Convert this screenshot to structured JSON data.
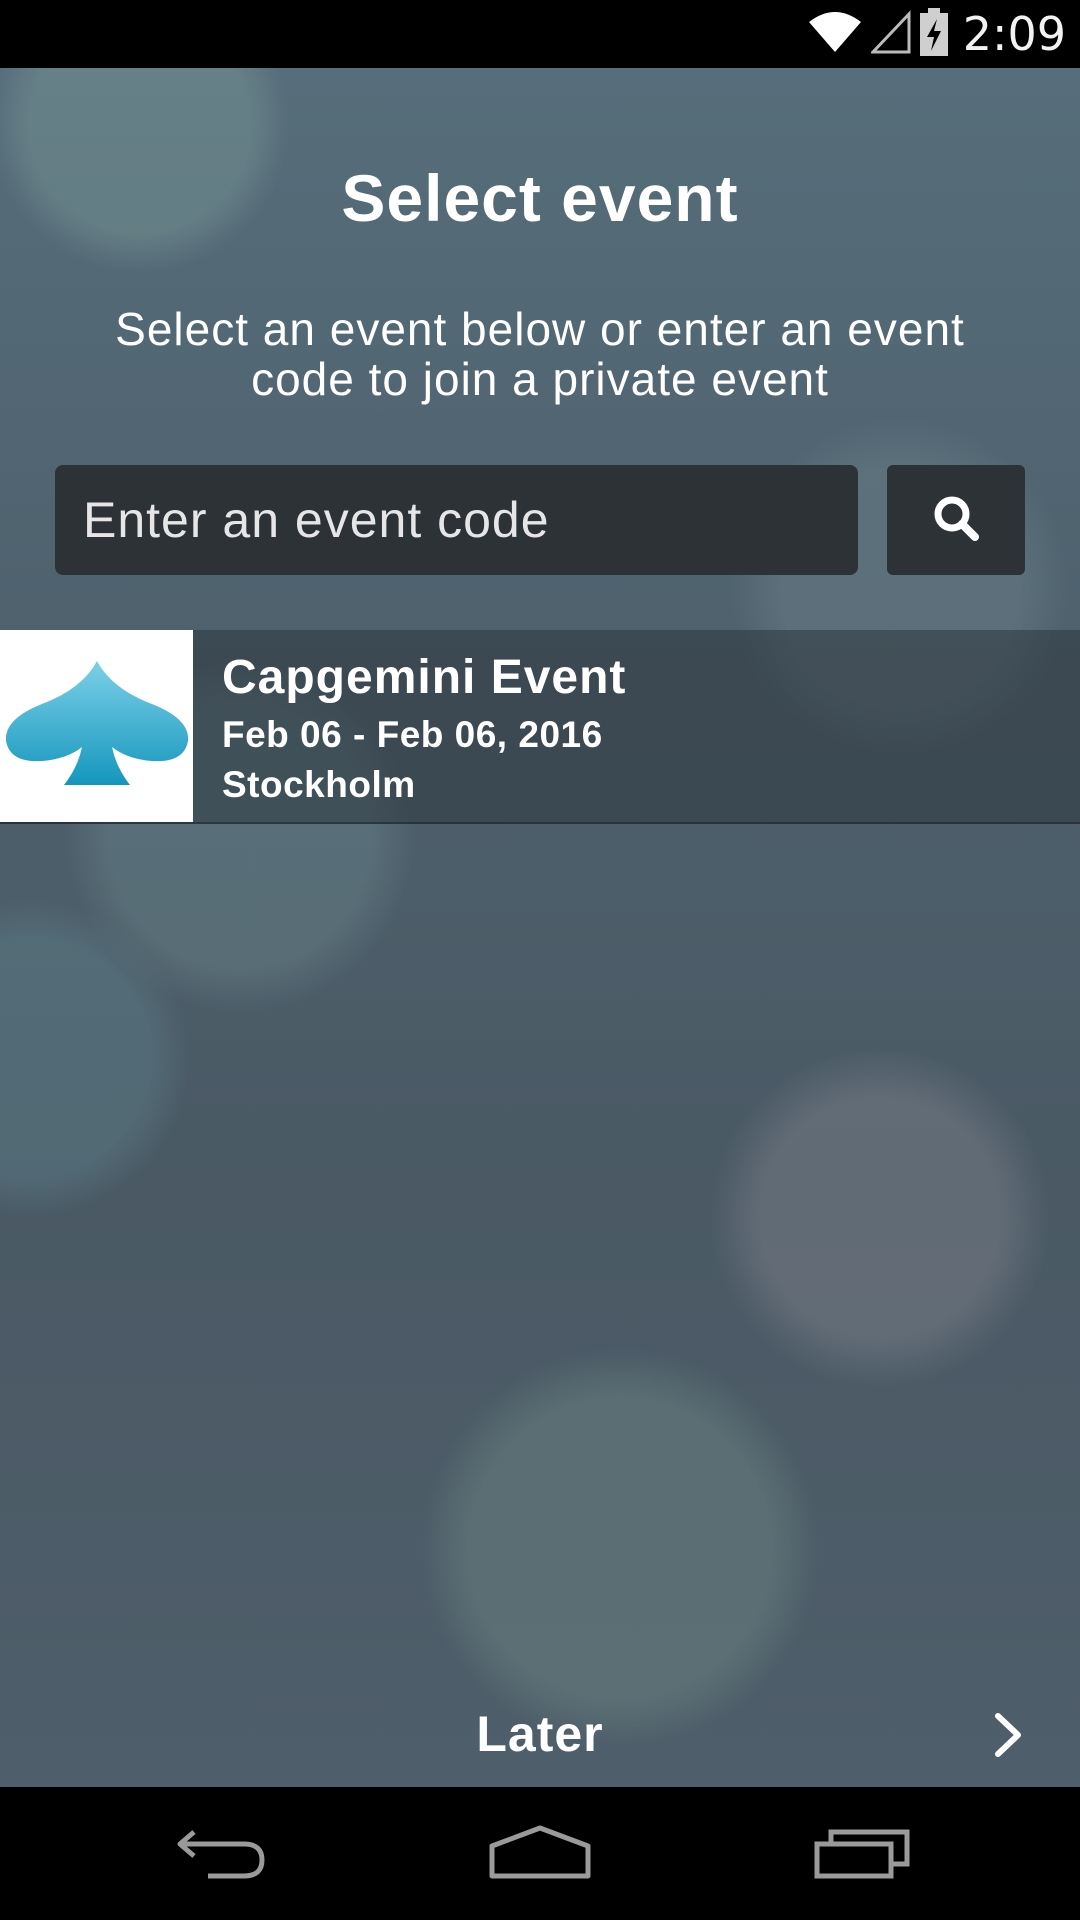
{
  "status_bar": {
    "time": "2:09",
    "icons": [
      "wifi-icon",
      "cell-signal-icon",
      "battery-charging-icon"
    ]
  },
  "header": {
    "title": "Select event",
    "subtitle": "Select an event below or enter an event code to join a private event"
  },
  "search": {
    "placeholder": "Enter an event code",
    "value": "",
    "button_icon": "search-icon"
  },
  "events": [
    {
      "name": "Capgemini Event",
      "dates": "Feb 06 - Feb 06, 2016",
      "location": "Stockholm",
      "logo_icon": "spade-logo-icon"
    }
  ],
  "footer": {
    "later_label": "Later",
    "arrow_icon": "chevron-right-icon"
  },
  "nav_bar": {
    "buttons": [
      "back-icon",
      "home-icon",
      "recents-icon"
    ]
  },
  "colors": {
    "field_bg": "#2c3236",
    "logo_blue": "#29a3c7",
    "text": "#ffffff"
  }
}
